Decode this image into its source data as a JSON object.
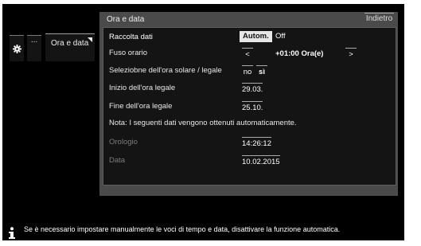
{
  "nav": {
    "dots_label": "...",
    "breadcrumb_label": "Ora e data"
  },
  "panel": {
    "title": "Ora e data",
    "back_label": "Indietro"
  },
  "settings": {
    "raccolta": {
      "label": "Raccolta dati",
      "option_auto": "Autom.",
      "option_off": "Off",
      "selected": "Autom."
    },
    "fuso": {
      "label": "Fuso orario",
      "prev": "<",
      "value": "+01:00 Ora(e)",
      "next": ">"
    },
    "ora_legale": {
      "label": "Seleziobne dell'ora solare / legale",
      "no": "no",
      "si": "sì",
      "selected": "sì"
    },
    "inizio": {
      "label": "Inizio dell'ora legale",
      "value": "29.03."
    },
    "fine": {
      "label": "Fine dell'ora legale",
      "value": "25.10."
    },
    "note": "Nota: I seguenti dati vengono ottenuti automaticamente.",
    "orologio": {
      "label": "Orologio",
      "value": "14:26:12"
    },
    "data": {
      "label": "Data",
      "value": "10.02.2015"
    }
  },
  "footer": {
    "info_text": "Se è necessario impostare manualmente le voci di tempo e data, disattivare la funzione automatica."
  },
  "colors": {
    "background": "#000000",
    "panel": "#4a4a4a",
    "content": "#141414",
    "selected_segment": "#e6e6e6",
    "dim_text": "#7d7d7d"
  }
}
